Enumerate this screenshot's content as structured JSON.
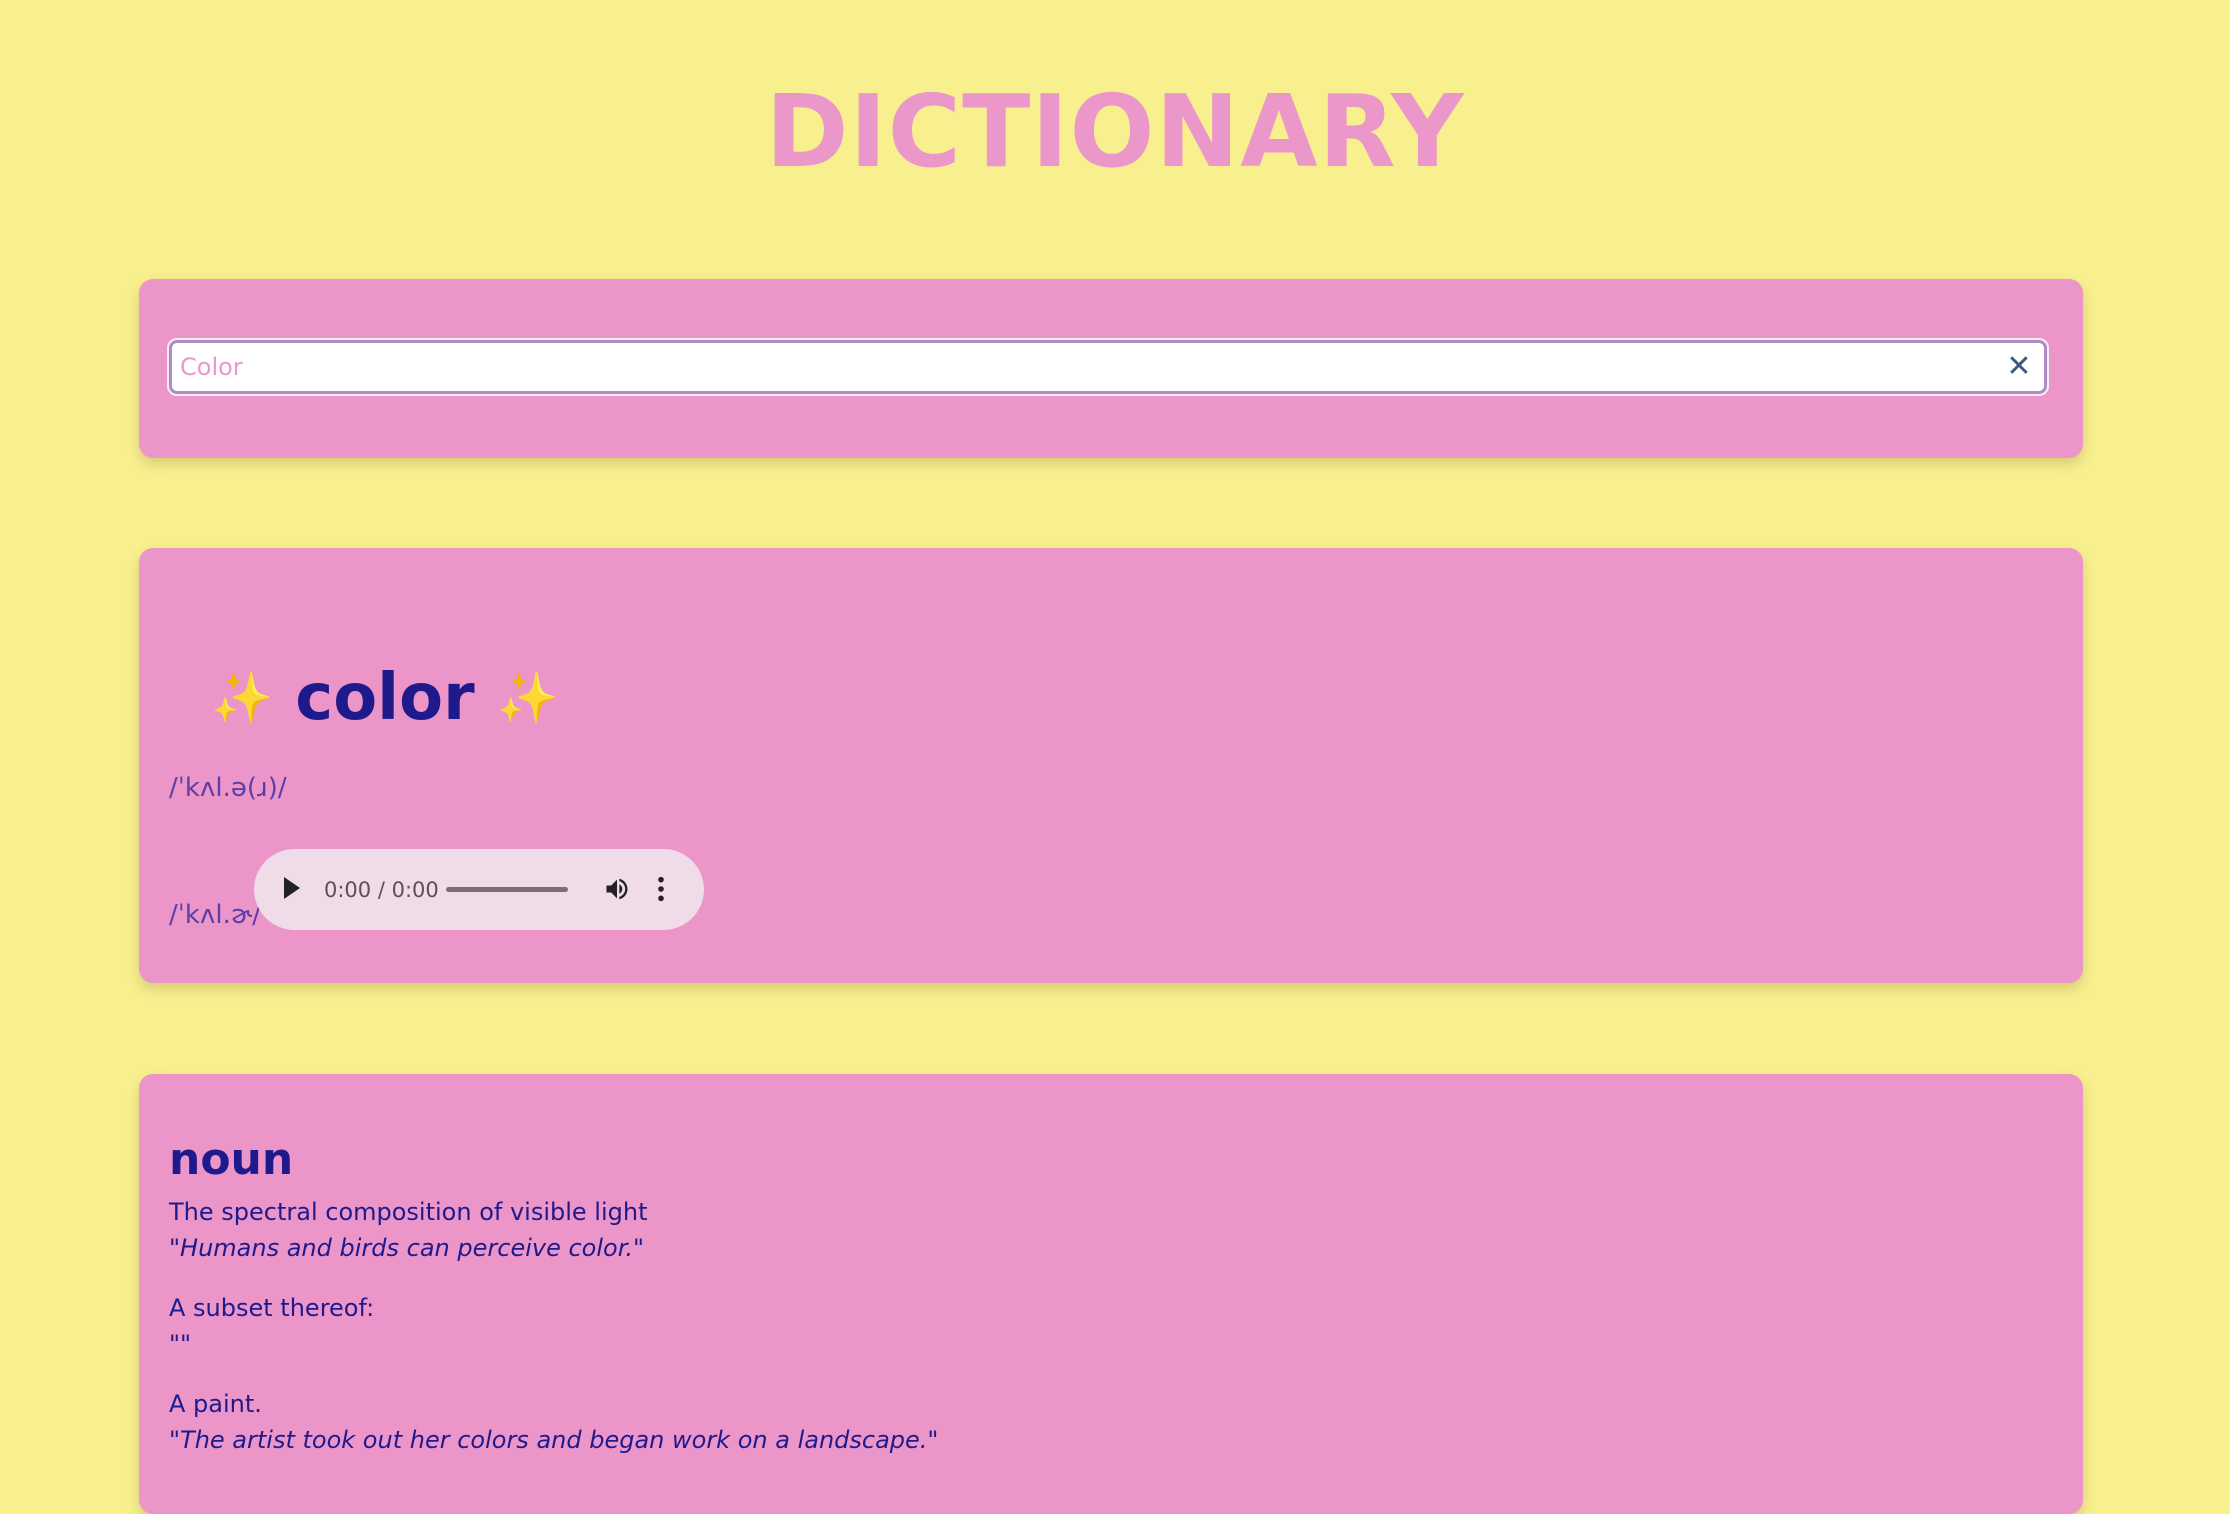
{
  "app": {
    "title": "DICTIONARY"
  },
  "search": {
    "value": "",
    "placeholder": "Color",
    "clear_icon": "close-icon"
  },
  "word": {
    "headword": "color",
    "sparkle_left": "✨",
    "sparkle_right": "✨",
    "phonetics": [
      {
        "text": "/ˈkʌl.ə(ɹ)/"
      },
      {
        "text": "/ˈkʌl.ɚ/"
      }
    ],
    "audio": {
      "time": "0:00 / 0:00",
      "progress": 0
    }
  },
  "meanings": [
    {
      "part_of_speech": "noun",
      "definitions": [
        {
          "definition": "The spectral composition of visible light",
          "example": "\"Humans and birds can perceive color.\""
        },
        {
          "definition": "A subset thereof:",
          "example": "\"\""
        },
        {
          "definition": "A paint.",
          "example": "\"The artist took out her colors and began work on a landscape.\""
        }
      ]
    }
  ],
  "colors": {
    "background": "#f8f08f",
    "card": "#ec95c9",
    "title": "#ec97ca",
    "text": "#1e1a8c",
    "phonetic": "#5b3fa8"
  }
}
